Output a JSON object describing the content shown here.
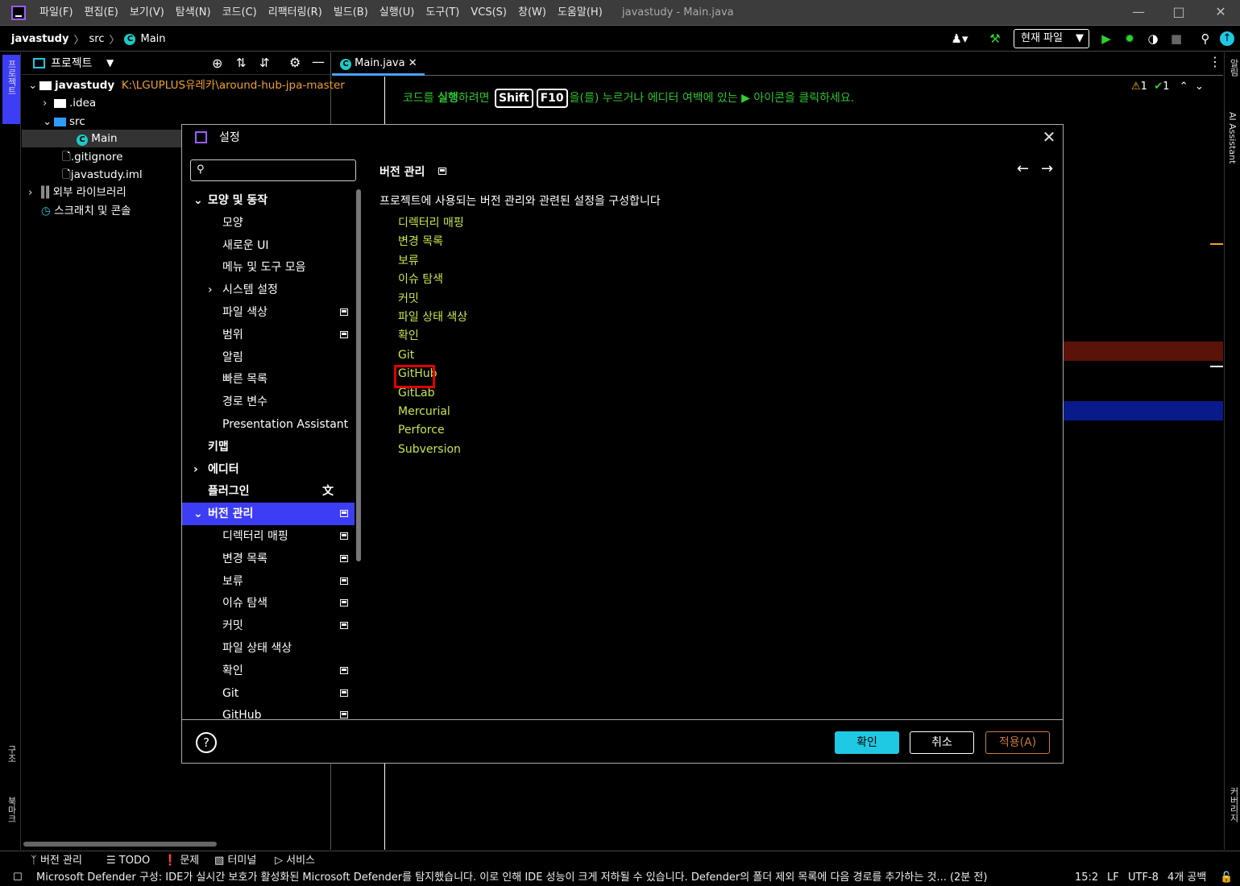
{
  "menu": {
    "items": [
      "파일(F)",
      "편집(E)",
      "보기(V)",
      "탐색(N)",
      "코드(C)",
      "리팩터링(R)",
      "빌드(B)",
      "실행(U)",
      "도구(T)",
      "VCS(S)",
      "창(W)",
      "도움말(H)"
    ],
    "window_title": "javastudy - Main.java"
  },
  "breadcrumb": {
    "project": "javastudy",
    "folder": "src",
    "file": "Main"
  },
  "toolbar": {
    "run_config": "현재 파일"
  },
  "left_stripe": {
    "project_label": "프로젝트",
    "structure_label": "구조",
    "bookmarks_label": "북마크"
  },
  "right_stripe": {
    "notifications_label": "알림",
    "ai_label": "AI Assistant",
    "coverage_label": "커버리지"
  },
  "project_panel": {
    "title": "프로젝트",
    "tree": {
      "root": "javastudy",
      "root_path": "K:\\LGUPLUS유레카\\around-hub-jpa-master",
      "idea": ".idea",
      "src": "src",
      "main": "Main",
      "gitignore": ".gitignore",
      "iml": "javastudy.iml",
      "external": "외부 라이브러리",
      "scratches": "스크래치 및 콘솔"
    }
  },
  "editor": {
    "tab_label": "Main.java",
    "hint_before": "코드를 ",
    "hint_run": "실행",
    "hint_mid": "하려면 ",
    "hint_key1": "Shift",
    "hint_key2": "F10",
    "hint_after": "을(를) 누르거나 에디터 여백에 있는",
    "hint_end": "아이콘을 클릭하세요.",
    "warnings": "1",
    "checks": "1"
  },
  "dialog": {
    "title": "설정",
    "search_placeholder": "",
    "nav": [
      {
        "label": "모양 및 동작",
        "level": 0,
        "bold": true,
        "expanded": true
      },
      {
        "label": "모양",
        "level": 1
      },
      {
        "label": "새로운 UI",
        "level": 1
      },
      {
        "label": "메뉴 및 도구 모음",
        "level": 1
      },
      {
        "label": "시스템 설정",
        "level": 1,
        "collapsed": true
      },
      {
        "label": "파일 색상",
        "level": 1,
        "badge": true
      },
      {
        "label": "범위",
        "level": 1,
        "badge": true
      },
      {
        "label": "알림",
        "level": 1
      },
      {
        "label": "빠른 목록",
        "level": 1
      },
      {
        "label": "경로 변수",
        "level": 1
      },
      {
        "label": "Presentation Assistant",
        "level": 1
      },
      {
        "label": "키맵",
        "level": 0,
        "bold": true
      },
      {
        "label": "에디터",
        "level": 0,
        "bold": true,
        "collapsed": true
      },
      {
        "label": "플러그인",
        "level": 0,
        "bold": true,
        "translate": true
      },
      {
        "label": "버전 관리",
        "level": 0,
        "bold": true,
        "expanded": true,
        "selected": true,
        "badge": true
      },
      {
        "label": "디렉터리 매핑",
        "level": 1,
        "badge": true
      },
      {
        "label": "변경 목록",
        "level": 1,
        "badge": true
      },
      {
        "label": "보류",
        "level": 1,
        "badge": true
      },
      {
        "label": "이슈 탐색",
        "level": 1,
        "badge": true
      },
      {
        "label": "커밋",
        "level": 1,
        "badge": true
      },
      {
        "label": "파일 상태 색상",
        "level": 1
      },
      {
        "label": "확인",
        "level": 1,
        "badge": true
      },
      {
        "label": "Git",
        "level": 1,
        "badge": true
      },
      {
        "label": "GitHub",
        "level": 1,
        "badge": true
      }
    ],
    "content": {
      "title": "버전 관리",
      "description": "프로젝트에 사용되는 버전 관리와 관련된 설정을 구성합니다",
      "links": [
        "디렉터리 매핑",
        "변경 목록",
        "보류",
        "이슈 탐색",
        "커밋",
        "파일 상태 색상",
        "확인",
        "Git",
        "GitHub",
        "GitLab",
        "Mercurial",
        "Perforce",
        "Subversion"
      ]
    },
    "buttons": {
      "ok": "확인",
      "cancel": "취소",
      "apply": "적용(A)"
    }
  },
  "tool_windows": [
    "버전 관리",
    "TODO",
    "문제",
    "터미널",
    "서비스"
  ],
  "status": {
    "message": "Microsoft Defender 구성: IDE가 실시간 보호가 활성화된 Microsoft Defender를 탐지했습니다. 이로 인해 IDE 성능이 크게 저하될 수 있습니다. Defender의 폴더 제외 목록에 다음 경로를 추가하는 것... (2분 전)",
    "position": "15:2",
    "line_sep": "LF",
    "encoding": "UTF-8",
    "indent": "4개 공백"
  },
  "colors": {
    "accent": "#3d3df5",
    "link": "#c7e64a",
    "ok_button": "#1fc9e4",
    "highlight": "#e00000",
    "hint": "#2fc42f"
  }
}
